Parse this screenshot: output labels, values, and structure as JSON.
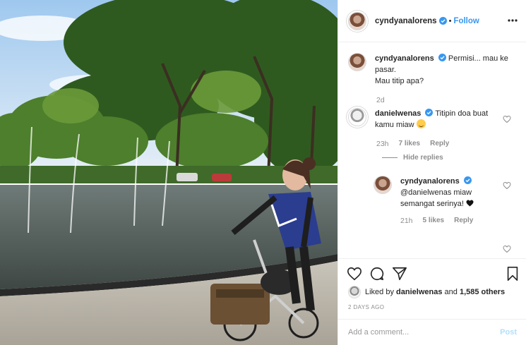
{
  "post": {
    "photo_alt": "",
    "author": {
      "username": "cyndyanalorens",
      "verified": true
    },
    "follow_label": "Follow",
    "dot": "•"
  },
  "comments": [
    {
      "username": "cyndyanalorens",
      "text_line1": "Permisi... mau ke",
      "text_line2": "pasar.",
      "text_line3": "Mau titip apa?",
      "time": "2d"
    },
    {
      "username": "danielwenas",
      "text_line1": "Titipin doa buat",
      "text_line2": "kamu miaw",
      "time": "23h",
      "likes": "7 likes",
      "reply_label": "Reply",
      "hide_replies_label": "Hide replies",
      "replies": [
        {
          "username": "cyndyanalorens",
          "text_line1": "@danielwenas miaw",
          "text_line2": "semangat serinya!",
          "time": "21h",
          "likes": "5 likes",
          "reply_label": "Reply"
        }
      ]
    }
  ],
  "likes_summary": {
    "prefix": "Liked by",
    "user": "danielwenas",
    "joiner": "and",
    "others": "1,585 others"
  },
  "posted_ago": "2 DAYS AGO",
  "add_comment": {
    "placeholder": "Add a comment...",
    "post_label": "Post"
  },
  "colors": {
    "accent": "#3897f0",
    "post_disabled": "#b2dffc",
    "verified": "#3897f0",
    "muted": "#8e8e8e"
  },
  "icons": [
    "verified-badge-icon",
    "more-options-icon",
    "heart-icon",
    "comment-icon",
    "share-icon",
    "bookmark-icon",
    "smile-emoji-icon",
    "black-heart-emoji-icon"
  ]
}
